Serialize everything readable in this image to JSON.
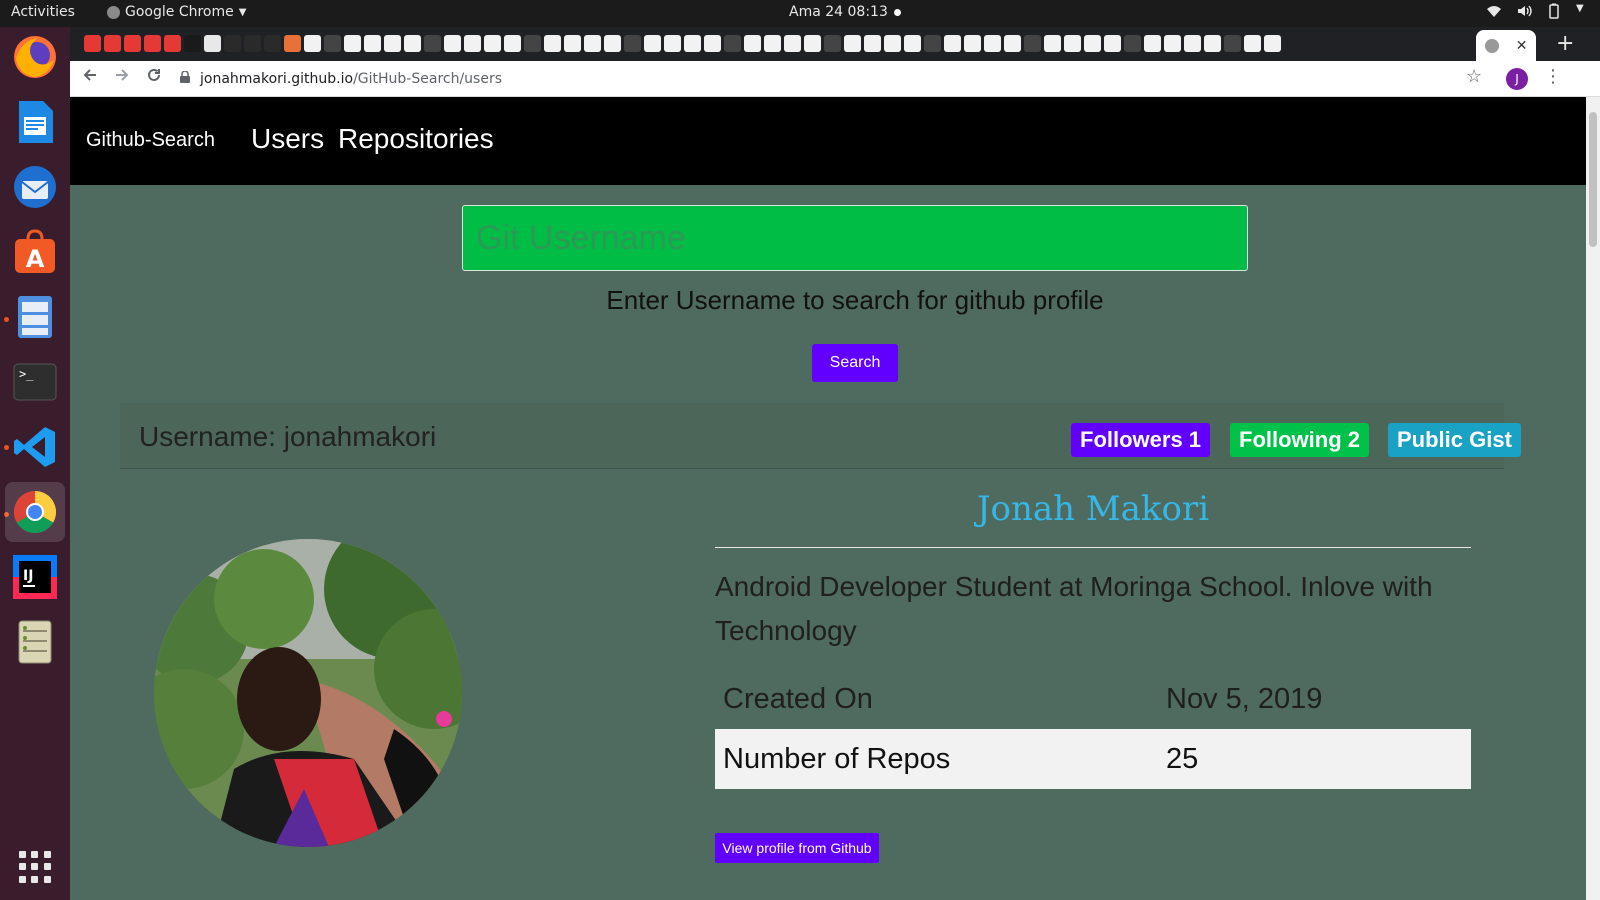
{
  "topbar": {
    "activities": "Activities",
    "app_name": "Google Chrome",
    "clock": "Ama 24  08:13"
  },
  "dock": {
    "apps": [
      "firefox-icon",
      "writer-icon",
      "thunderbird-icon",
      "software-icon",
      "files-icon",
      "terminal-icon",
      "vscode-icon",
      "chrome-icon",
      "intellij-icon",
      "archive-icon"
    ]
  },
  "browser": {
    "url_host": "jonahmakori.github.io",
    "url_path": "/GitHub-Search/users",
    "profile_initial": "J",
    "new_tab": "+",
    "close_tab": "✕"
  },
  "site": {
    "brand": "Github-Search",
    "nav": [
      "Users",
      "Repositories"
    ],
    "search_placeholder": "Git Username",
    "hint": "Enter Username to search for github profile",
    "search_button": "Search"
  },
  "profile": {
    "username_line": "Username: jonahmakori",
    "badges": [
      {
        "label": "Followers 1",
        "color": "#6200ff"
      },
      {
        "label": "Following 2",
        "color": "#00c14a"
      },
      {
        "label": "Public Gist",
        "color": "#1aa2c4"
      }
    ],
    "name": "Jonah Makori",
    "bio": "Android Developer Student at Moringa School. Inlove with Technology",
    "created_label": "Created On",
    "created_value": "Nov 5, 2019",
    "repos_label": "Number of Repos",
    "repos_value": "25",
    "view_button": "View profile from Github"
  }
}
